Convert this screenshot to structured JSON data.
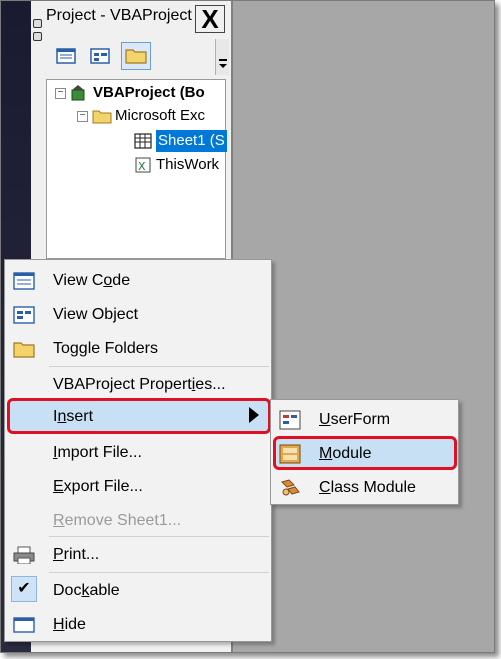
{
  "window": {
    "title": "Project - VBAProject",
    "close_label": "X"
  },
  "toolbar": {
    "buttons": [
      "view-code",
      "view-object",
      "toggle-folders"
    ]
  },
  "tree": {
    "items": [
      {
        "label": "VBAProject (Bo",
        "level": 0
      },
      {
        "label": "Microsoft Exc",
        "level": 1
      },
      {
        "label": "Sheet1 (S",
        "level": 2,
        "selected": true
      },
      {
        "label": "ThisWork",
        "level": 2
      }
    ]
  },
  "context_menu": {
    "items": [
      {
        "pre": "View C",
        "acc": "o",
        "post": "de",
        "icon": "view-code-icon"
      },
      {
        "pre": "View Ob",
        "acc": "j",
        "post": "ect",
        "icon": "view-object-icon"
      },
      {
        "pre": "Toggle Folders",
        "acc": "",
        "post": "",
        "icon": "folder-icon"
      },
      {
        "pre": "VBAProject Propert",
        "acc": "i",
        "post": "es...",
        "icon": ""
      },
      {
        "pre": "I",
        "acc": "n",
        "post": "sert",
        "icon": "",
        "highlighted": true
      },
      {
        "pre": "",
        "acc": "I",
        "post": "mport File...",
        "icon": ""
      },
      {
        "pre": "",
        "acc": "E",
        "post": "xport File...",
        "icon": ""
      },
      {
        "pre": "",
        "acc": "R",
        "post": "emove Sheet1...",
        "icon": "",
        "disabled": true
      },
      {
        "pre": "",
        "acc": "P",
        "post": "rint...",
        "icon": "printer-icon"
      },
      {
        "pre": "Doc",
        "acc": "k",
        "post": "able",
        "icon": "checkmark-icon",
        "checked": true
      },
      {
        "pre": "",
        "acc": "H",
        "post": "ide",
        "icon": "hide-icon"
      }
    ]
  },
  "submenu": {
    "items": [
      {
        "pre": "",
        "acc": "U",
        "post": "serForm",
        "icon": "userform-icon"
      },
      {
        "pre": "",
        "acc": "M",
        "post": "odule",
        "icon": "module-icon",
        "highlighted": true
      },
      {
        "pre": "",
        "acc": "C",
        "post": "lass Module",
        "icon": "class-module-icon"
      }
    ]
  },
  "colors": {
    "selection": "#0078d7",
    "highlight_fill": "#c7e0f4",
    "annotation_red": "#e01020"
  }
}
